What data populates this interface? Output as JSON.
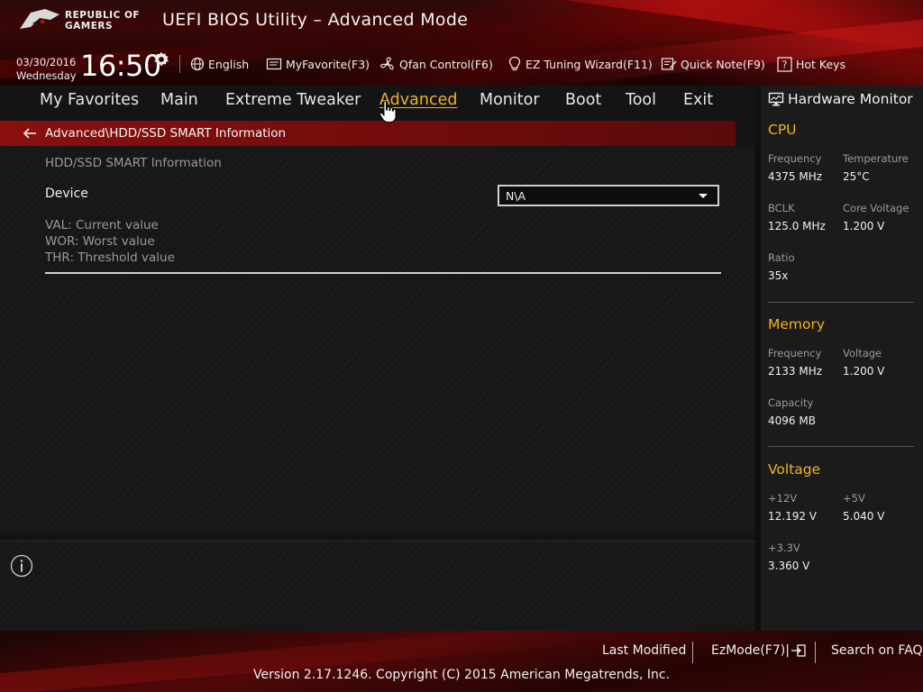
{
  "header": {
    "brand_line1": "REPUBLIC OF",
    "brand_line2": "GAMERS",
    "title": "UEFI BIOS Utility – Advanced Mode",
    "date": "03/30/2016",
    "weekday": "Wednesday",
    "time": "16:50"
  },
  "toolbar": {
    "language": "English",
    "my_favorite": "MyFavorite(F3)",
    "qfan": "Qfan Control(F6)",
    "ez_tuning": "EZ Tuning Wizard(F11)",
    "quick_note": "Quick Note(F9)",
    "hot_keys": "Hot Keys"
  },
  "nav": {
    "tabs": [
      {
        "label": "My Favorites"
      },
      {
        "label": "Main"
      },
      {
        "label": "Extreme Tweaker"
      },
      {
        "label": "Advanced"
      },
      {
        "label": "Monitor"
      },
      {
        "label": "Boot"
      },
      {
        "label": "Tool"
      },
      {
        "label": "Exit"
      }
    ],
    "active": "Advanced"
  },
  "breadcrumb": {
    "path": "Advanced\\HDD/SSD SMART Information"
  },
  "main": {
    "section_title": "HDD/SSD SMART Information",
    "device_label": "Device",
    "device_value": "N\\A",
    "legend": [
      "VAL:  Current value",
      "WOR: Worst value",
      "THR:  Threshold value"
    ]
  },
  "hwmon": {
    "title": "Hardware Monitor",
    "cpu": {
      "section": "CPU",
      "frequency_label": "Frequency",
      "frequency": "4375 MHz",
      "temperature_label": "Temperature",
      "temperature": "25°C",
      "bclk_label": "BCLK",
      "bclk": "125.0 MHz",
      "core_voltage_label": "Core Voltage",
      "core_voltage": "1.200 V",
      "ratio_label": "Ratio",
      "ratio": "35x"
    },
    "memory": {
      "section": "Memory",
      "frequency_label": "Frequency",
      "frequency": "2133 MHz",
      "voltage_label": "Voltage",
      "voltage": "1.200 V",
      "capacity_label": "Capacity",
      "capacity": "4096 MB"
    },
    "voltage": {
      "section": "Voltage",
      "v12_label": "+12V",
      "v12": "12.192 V",
      "v5_label": "+5V",
      "v5": "5.040 V",
      "v33_label": "+3.3V",
      "v33": "3.360 V"
    }
  },
  "footer": {
    "last_modified": "Last Modified",
    "ez_mode": "EzMode(F7)|",
    "search_faq": "Search on FAQ",
    "copyright": "Version 2.17.1246. Copyright (C) 2015 American Megatrends, Inc."
  },
  "colors": {
    "accent": "#f0b323",
    "breadcrumb_red": "#8a0f0f",
    "background": "#141414"
  },
  "icons": [
    "rog-eye-icon",
    "gear-icon",
    "globe-icon",
    "favorite-icon",
    "fan-icon",
    "bulb-icon",
    "note-icon",
    "help-icon",
    "back-arrow-icon",
    "monitor-icon",
    "info-icon",
    "exit-icon",
    "hand-cursor-icon"
  ]
}
